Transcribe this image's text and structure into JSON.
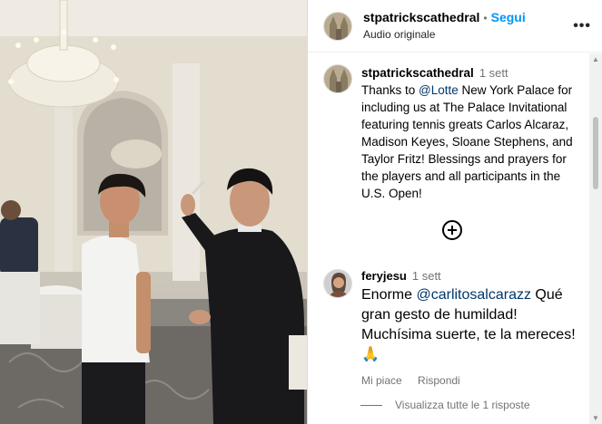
{
  "post": {
    "username": "stpatrickscathedral",
    "separator": "•",
    "follow_label": "Segui",
    "audio_label": "Audio originale",
    "more_icon": "more-horizontal-icon"
  },
  "caption": {
    "username": "stpatrickscathedral",
    "time": "1 sett",
    "text_before": "Thanks to ",
    "mention": "@Lotte",
    "text_after": " New York Palace for including us at The Palace Invitational featuring tennis greats Carlos Alcaraz, Madison Keyes, Sloane Stephens, and Taylor Fritz! Blessings and prayers for the players and all participants in the U.S. Open!"
  },
  "load_more_icon": "plus-circle-icon",
  "comment": {
    "username": "feryjesu",
    "time": "1 sett",
    "text_before": "Enorme ",
    "mention": "@carlitosalcarazz",
    "text_after": " Qué gran gesto de humildad! Muchísima suerte, te la mereces! 🙏",
    "like_label": "Mi piace",
    "reply_label": "Rispondi",
    "view_replies": "Visualizza tutte le 1 risposte"
  },
  "colors": {
    "link": "#0095f6",
    "mention": "#00376b",
    "muted": "#737373"
  }
}
